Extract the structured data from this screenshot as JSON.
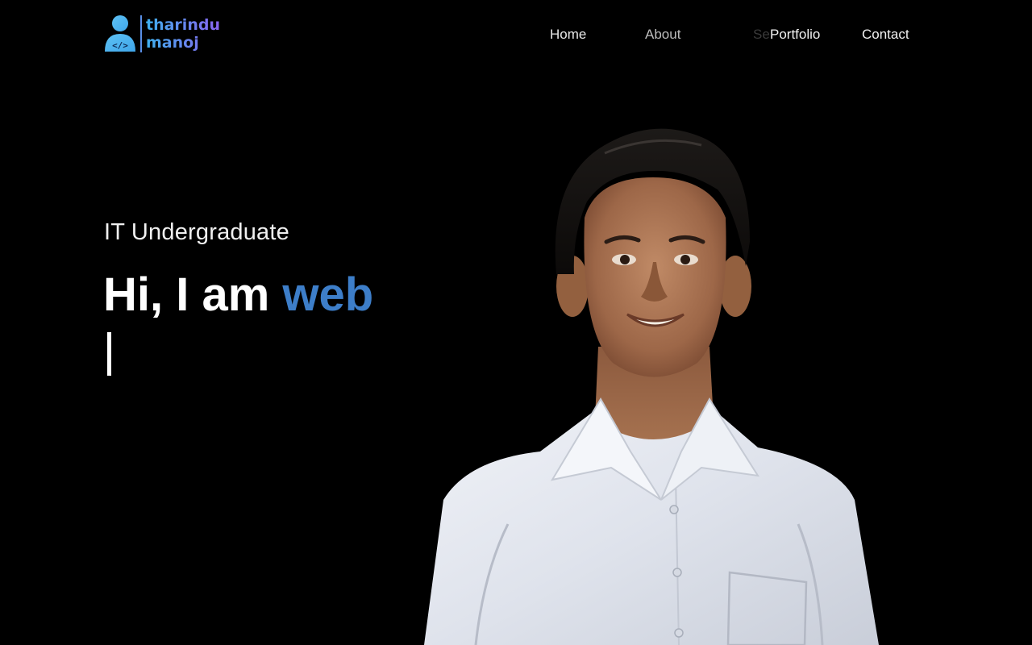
{
  "brand": {
    "line1": "tharindu",
    "line2": "manoj",
    "icon": "developer-user-code-icon",
    "gradient_start": "#3fb0ee",
    "gradient_end": "#8a63f0"
  },
  "nav": {
    "home": "Home",
    "about": "About",
    "services": "Se",
    "portfolio": "Portfolio",
    "contact": "Contact"
  },
  "hero": {
    "subtitle": "IT Undergraduate",
    "headline_prefix": "Hi, I am ",
    "headline_typed": "web",
    "accent_color": "#3d7ec9",
    "background": "#000000"
  },
  "portrait": {
    "kind": "photo-of-person-smiling-white-shirt"
  }
}
